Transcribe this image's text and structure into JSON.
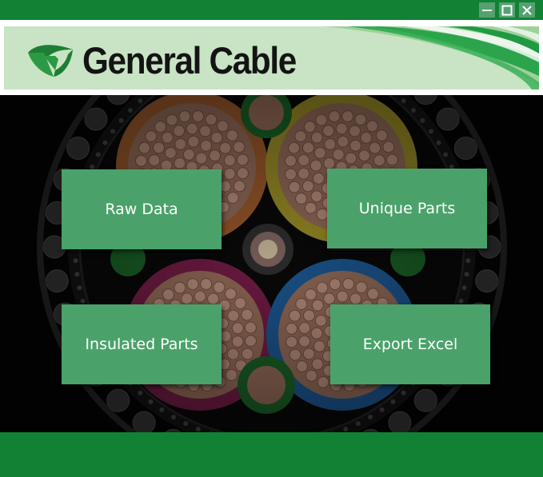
{
  "window": {
    "controls": {
      "minimize_icon": "minimize-icon",
      "maximize_icon": "maximize-icon",
      "close_icon": "close-icon"
    }
  },
  "header": {
    "logo_text": "General Cable",
    "logo_icon": "general-cable-logo-icon"
  },
  "tiles": {
    "raw_data": "Raw Data",
    "unique_parts": "Unique Parts",
    "insulated_parts": "Insulated Parts",
    "export_excel": "Export Excel"
  },
  "colors": {
    "titlebar": "#118233",
    "tile": "#4aa26a",
    "banner": "#c8e4c4",
    "footer": "#118233"
  }
}
